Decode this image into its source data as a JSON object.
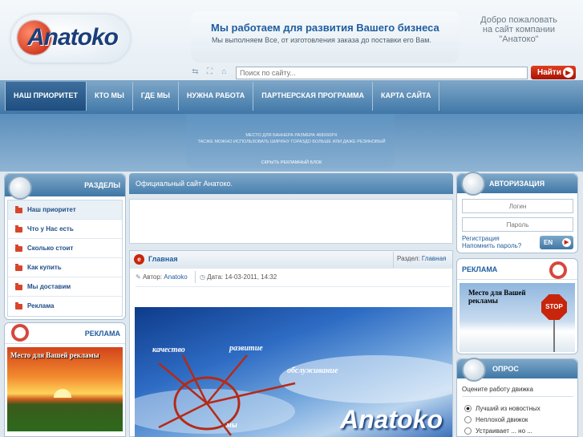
{
  "header": {
    "logo_text": "Anatoko",
    "slogan_title": "Мы работаем для развития Вашего бизнеса",
    "slogan_sub": "Мы выполняем Все, от изготовления заказа до поставки его Вам.",
    "welcome_line1": "Добро пожаловать",
    "welcome_line2": "на сайт компании",
    "welcome_line3": "\"Анатоко\""
  },
  "toolbar": {
    "search_placeholder": "Поиск по сайту...",
    "search_button": "Найти"
  },
  "nav": {
    "items": [
      "НАШ ПРИОРИТЕТ",
      "КТО МЫ",
      "ГДЕ МЫ",
      "НУЖНА РАБОТА",
      "ПАРТНЕРСКАЯ ПРОГРАММА",
      "КАРТА САЙТА"
    ]
  },
  "banner": {
    "line1": "МЕСТО ДЛЯ БАННЕРА РАЗМЕРА 468X60PX",
    "line2": "ТАСЖЕ МОЖНО ИСПОЛЬЗОВАТЬ ШИРИНУ ГОРАЗДО БОЛЬШЕ ИЛИ ДАЖЕ РЕЗИНОВЫЙ",
    "hide_link": "СКРЫТЬ РЕКЛАМНЫЙ БЛОК"
  },
  "sections": {
    "title": "РАЗДЕЛЫ",
    "items": [
      "Наш приоритет",
      "Что у Нас есть",
      "Сколько стоит",
      "Как купить",
      "Мы доставим",
      "Реклама"
    ]
  },
  "left_ad": {
    "title": "РЕКЛАМА",
    "caption": "Место для Вашей рекламы"
  },
  "center": {
    "official": "Официальный сайт Анатоко.",
    "article_title": "Главная",
    "section_label": "Раздел:",
    "section_value": "Главная",
    "author_label": "Автор:",
    "author_value": "Anatoko",
    "date_label": "Дата:",
    "date_value": "14-03-2011, 14:32",
    "image_words": [
      "качество",
      "развитие",
      "обслуживание",
      "мы"
    ],
    "image_logo": "Anatoko"
  },
  "auth": {
    "title": "АВТОРИЗАЦИЯ",
    "login_placeholder": "Логин",
    "password_placeholder": "Пароль",
    "register_link": "Регистрация",
    "remind_link": "Напомнить пароль?",
    "enter_button": "EN"
  },
  "right_ad": {
    "title": "РЕКЛАМА",
    "caption": "Место для Вашей рекламы",
    "sign_text": "STOP"
  },
  "poll": {
    "title": "ОПРОС",
    "question": "Оцените работу движка",
    "options": [
      "Лучший из новостных",
      "Неплохой движок",
      "Устраивает ... но ..."
    ],
    "selected": 0
  },
  "colors": {
    "accent": "#1f5d9e",
    "nav": "#3f77a8",
    "search_button": "#c8260c"
  }
}
